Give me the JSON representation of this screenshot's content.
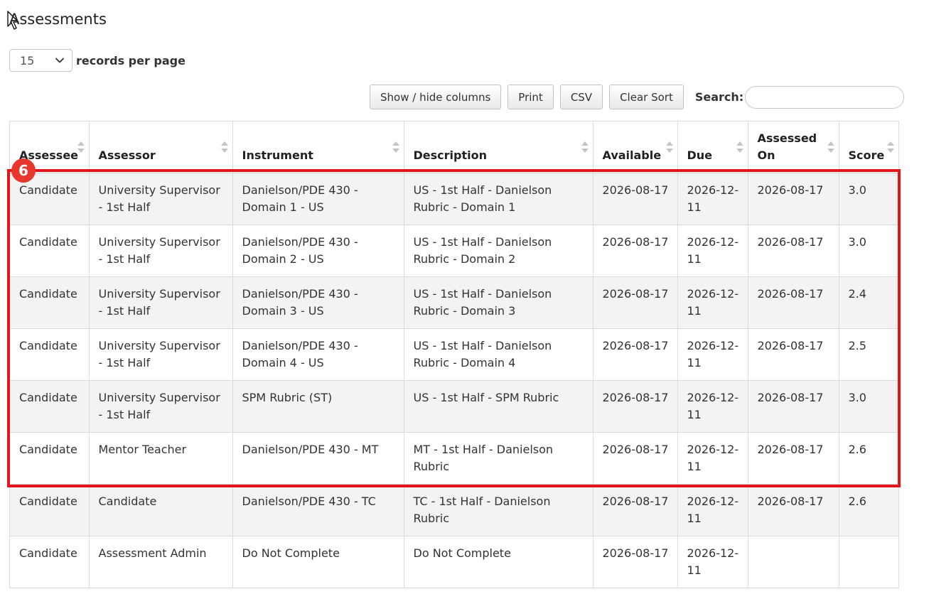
{
  "page": {
    "title": "Assessments"
  },
  "length_menu": {
    "selected": "15",
    "label": "records per page"
  },
  "toolbar": {
    "show_hide_label": "Show / hide columns",
    "print_label": "Print",
    "csv_label": "CSV",
    "clear_sort_label": "Clear Sort",
    "search_label": "Search:",
    "search_value": ""
  },
  "table": {
    "columns": [
      "Assessee",
      "Assessor",
      "Instrument",
      "Description",
      "Available",
      "Due",
      "Assessed On",
      "Score"
    ],
    "rows": [
      [
        "Candidate",
        "University Supervisor - 1st Half",
        "Danielson/PDE 430 - Domain 1 - US",
        "US - 1st Half - Danielson Rubric - Domain 1",
        "2026-08-17",
        "2026-12-11",
        "2026-08-17",
        "3.0"
      ],
      [
        "Candidate",
        "University Supervisor - 1st Half",
        "Danielson/PDE 430 - Domain 2 - US",
        "US - 1st Half - Danielson Rubric - Domain 2",
        "2026-08-17",
        "2026-12-11",
        "2026-08-17",
        "3.0"
      ],
      [
        "Candidate",
        "University Supervisor - 1st Half",
        "Danielson/PDE 430 - Domain 3 - US",
        "US - 1st Half - Danielson Rubric - Domain 3",
        "2026-08-17",
        "2026-12-11",
        "2026-08-17",
        "2.4"
      ],
      [
        "Candidate",
        "University Supervisor - 1st Half",
        "Danielson/PDE 430 - Domain 4 - US",
        "US - 1st Half - Danielson Rubric - Domain 4",
        "2026-08-17",
        "2026-12-11",
        "2026-08-17",
        "2.5"
      ],
      [
        "Candidate",
        "University Supervisor - 1st Half",
        "SPM Rubric (ST)",
        "US - 1st Half - SPM Rubric",
        "2026-08-17",
        "2026-12-11",
        "2026-08-17",
        "3.0"
      ],
      [
        "Candidate",
        "Mentor Teacher",
        "Danielson/PDE 430 - MT",
        "MT - 1st Half - Danielson Rubric",
        "2026-08-17",
        "2026-12-11",
        "2026-08-17",
        "2.6"
      ],
      [
        "Candidate",
        "Candidate",
        "Danielson/PDE 430 - TC",
        "TC - 1st Half - Danielson Rubric",
        "2026-08-17",
        "2026-12-11",
        "2026-08-17",
        "2.6"
      ],
      [
        "Candidate",
        "Assessment Admin",
        "Do Not Complete",
        "Do Not Complete",
        "2026-08-17",
        "2026-12-11",
        "",
        ""
      ]
    ]
  },
  "annotation": {
    "badge_number": "6",
    "color": "#e3141c"
  }
}
